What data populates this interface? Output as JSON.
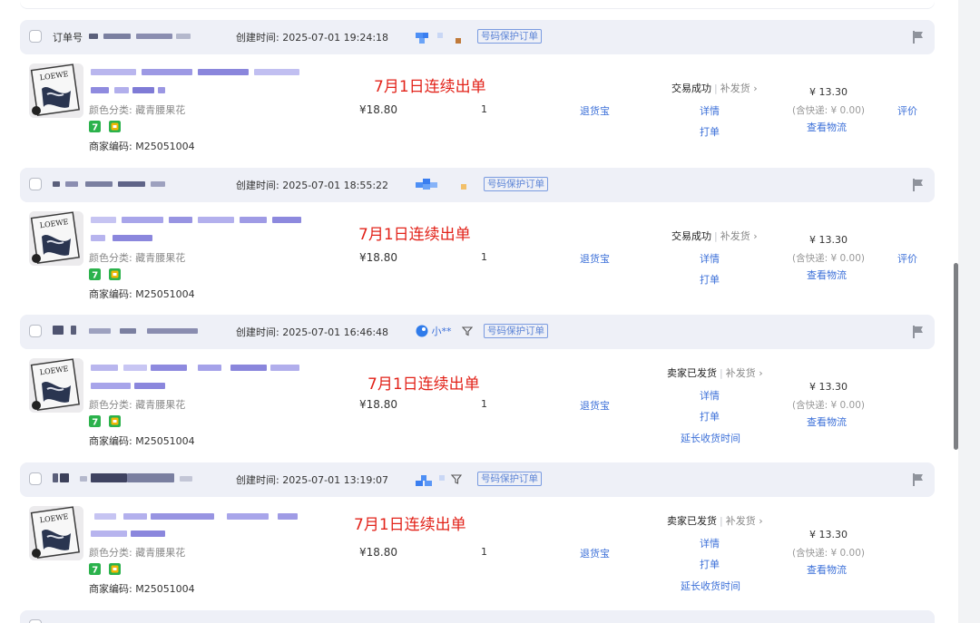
{
  "header": {
    "order_label": "订单号",
    "created_prefix": "创建时间: ",
    "protect_tag": "号码保护订单"
  },
  "item": {
    "attr_label": "颜色分类: 藏青腰果花",
    "code_label": "商家编码: M25051004",
    "thumb_text": "LOEWE",
    "price": "¥18.80",
    "qty": "1",
    "refund_label": "退货宝",
    "note": "7月1日连续出单",
    "badge_num": "7"
  },
  "actions": {
    "details": "详情",
    "print": "打单",
    "extend": "延长收货时间",
    "review": "评价",
    "logistics": "查看物流",
    "reship": "补发货"
  },
  "totals": {
    "amount": "¥ 13.30",
    "shipping": "(含快递: ¥ 0.00)"
  },
  "orders": [
    {
      "created": "2025-07-01 19:24:18",
      "status": "交易成功",
      "buyer": ""
    },
    {
      "created": "2025-07-01 18:55:22",
      "status": "交易成功",
      "buyer": ""
    },
    {
      "created": "2025-07-01 16:46:48",
      "status": "卖家已发货",
      "buyer": "小**"
    },
    {
      "created": "2025-07-01 13:19:07",
      "status": "卖家已发货",
      "buyer": ""
    }
  ],
  "colors": {
    "link": "#3b6fd8",
    "note": "#e2231a",
    "header_bg": "#eef0f7",
    "badge_green": "#2bb24c",
    "badge_yellow": "#f2b705"
  }
}
